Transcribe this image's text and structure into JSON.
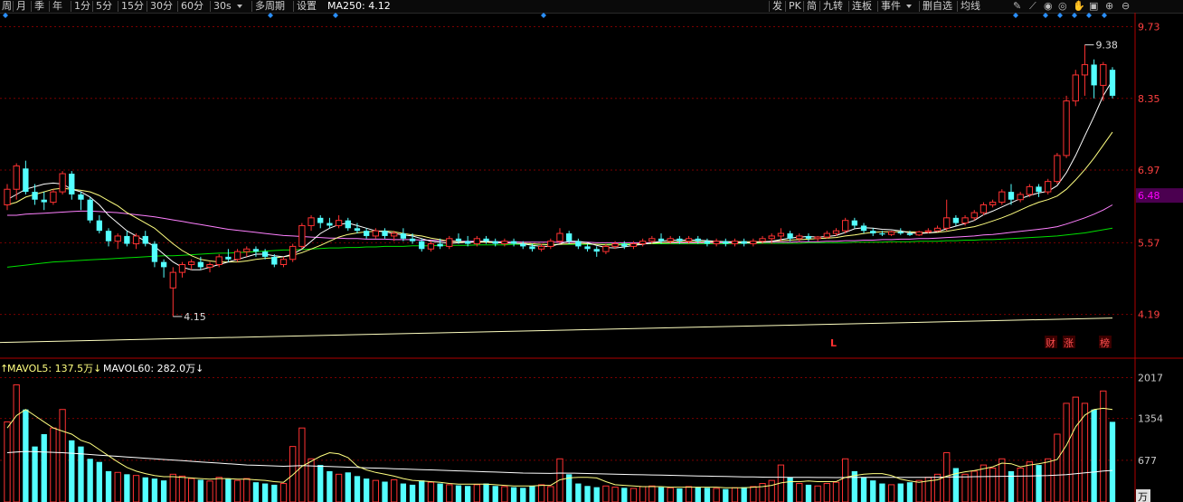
{
  "toolbar": {
    "left_items": [
      "周",
      "月",
      "季",
      "年",
      "1分",
      "5分",
      "15分",
      "30分",
      "60分",
      "30s",
      "多周期",
      "设置"
    ],
    "ma_label": "MA250: 4.12",
    "right_items": [
      "发",
      "PK",
      "简",
      "九转",
      "连板",
      "事件",
      "删自选",
      "均线"
    ]
  },
  "price_axis": {
    "ticks": [
      "9.73",
      "8.35",
      "6.97",
      "5.57",
      "4.19"
    ],
    "current_price": "6.48",
    "current_color": "#ff00ff"
  },
  "annotations": {
    "high_label": "9.38",
    "low_label": "4.15",
    "marker_l": "L",
    "markers_right": [
      "财",
      "涨",
      "榜"
    ]
  },
  "volume_panel": {
    "mavol5_label": "MAVOL5: 137.5万",
    "mavol60_label": "MAVOL60: 282.0万",
    "ticks": [
      "2017",
      "1354",
      "677"
    ],
    "unit": "万"
  },
  "colors": {
    "up": "#ff3232",
    "down": "#54ffff",
    "grid": "#7a0000",
    "ma5": "#ffffff",
    "ma10": "#ffff80",
    "ma30": "#ff80ff",
    "ma60": "#00e000",
    "ma250": "#ffffc0"
  },
  "chart_data": {
    "type": "candlestick",
    "y_range": [
      3.4,
      10.0
    ],
    "vol_range": [
      0,
      2200
    ],
    "high": 9.38,
    "low": 4.15,
    "ohlc": [
      [
        6.3,
        6.7,
        6.2,
        6.6
      ],
      [
        6.6,
        7.1,
        6.4,
        7.05
      ],
      [
        7.0,
        7.15,
        6.5,
        6.55
      ],
      [
        6.55,
        6.7,
        6.3,
        6.4
      ],
      [
        6.4,
        6.55,
        6.2,
        6.35
      ],
      [
        6.35,
        6.6,
        6.3,
        6.55
      ],
      [
        6.55,
        6.95,
        6.5,
        6.9
      ],
      [
        6.9,
        6.95,
        6.4,
        6.5
      ],
      [
        6.5,
        6.55,
        6.2,
        6.4
      ],
      [
        6.4,
        6.45,
        5.95,
        6.0
      ],
      [
        6.0,
        6.1,
        5.75,
        5.8
      ],
      [
        5.8,
        5.85,
        5.5,
        5.6
      ],
      [
        5.6,
        5.75,
        5.45,
        5.7
      ],
      [
        5.7,
        5.8,
        5.5,
        5.55
      ],
      [
        5.55,
        5.75,
        5.45,
        5.7
      ],
      [
        5.7,
        5.8,
        5.5,
        5.55
      ],
      [
        5.55,
        5.6,
        5.1,
        5.2
      ],
      [
        5.2,
        5.25,
        4.9,
        5.1
      ],
      [
        4.7,
        5.1,
        4.15,
        5.0
      ],
      [
        5.0,
        5.2,
        4.9,
        5.15
      ],
      [
        5.15,
        5.25,
        5.05,
        5.2
      ],
      [
        5.2,
        5.3,
        5.05,
        5.1
      ],
      [
        5.1,
        5.2,
        5.0,
        5.15
      ],
      [
        5.15,
        5.35,
        5.1,
        5.3
      ],
      [
        5.3,
        5.45,
        5.2,
        5.25
      ],
      [
        5.25,
        5.45,
        5.2,
        5.4
      ],
      [
        5.4,
        5.5,
        5.3,
        5.45
      ],
      [
        5.45,
        5.5,
        5.3,
        5.4
      ],
      [
        5.4,
        5.45,
        5.25,
        5.3
      ],
      [
        5.3,
        5.35,
        5.1,
        5.15
      ],
      [
        5.15,
        5.3,
        5.1,
        5.25
      ],
      [
        5.25,
        5.55,
        5.2,
        5.5
      ],
      [
        5.5,
        5.95,
        5.45,
        5.9
      ],
      [
        5.9,
        6.1,
        5.8,
        6.05
      ],
      [
        6.05,
        6.1,
        5.85,
        5.95
      ],
      [
        5.95,
        6.05,
        5.85,
        5.9
      ],
      [
        5.9,
        6.1,
        5.85,
        6.0
      ],
      [
        6.0,
        6.05,
        5.8,
        5.85
      ],
      [
        5.85,
        5.95,
        5.75,
        5.8
      ],
      [
        5.8,
        5.85,
        5.65,
        5.7
      ],
      [
        5.7,
        5.85,
        5.65,
        5.8
      ],
      [
        5.8,
        5.85,
        5.65,
        5.7
      ],
      [
        5.7,
        5.8,
        5.6,
        5.75
      ],
      [
        5.75,
        5.85,
        5.6,
        5.65
      ],
      [
        5.65,
        5.75,
        5.55,
        5.6
      ],
      [
        5.6,
        5.65,
        5.4,
        5.45
      ],
      [
        5.45,
        5.6,
        5.4,
        5.55
      ],
      [
        5.55,
        5.65,
        5.45,
        5.5
      ],
      [
        5.5,
        5.7,
        5.45,
        5.65
      ],
      [
        5.65,
        5.75,
        5.55,
        5.6
      ],
      [
        5.6,
        5.7,
        5.5,
        5.55
      ],
      [
        5.55,
        5.7,
        5.5,
        5.65
      ],
      [
        5.65,
        5.7,
        5.55,
        5.6
      ],
      [
        5.6,
        5.65,
        5.5,
        5.55
      ],
      [
        5.55,
        5.65,
        5.5,
        5.6
      ],
      [
        5.6,
        5.65,
        5.5,
        5.55
      ],
      [
        5.55,
        5.6,
        5.45,
        5.5
      ],
      [
        5.5,
        5.55,
        5.4,
        5.45
      ],
      [
        5.45,
        5.55,
        5.4,
        5.5
      ],
      [
        5.5,
        5.65,
        5.45,
        5.6
      ],
      [
        5.6,
        5.85,
        5.55,
        5.75
      ],
      [
        5.75,
        5.8,
        5.55,
        5.6
      ],
      [
        5.6,
        5.65,
        5.45,
        5.5
      ],
      [
        5.5,
        5.55,
        5.4,
        5.45
      ],
      [
        5.45,
        5.5,
        5.3,
        5.4
      ],
      [
        5.4,
        5.55,
        5.35,
        5.5
      ],
      [
        5.5,
        5.6,
        5.45,
        5.55
      ],
      [
        5.55,
        5.6,
        5.45,
        5.5
      ],
      [
        5.5,
        5.6,
        5.45,
        5.55
      ],
      [
        5.55,
        5.65,
        5.5,
        5.6
      ],
      [
        5.6,
        5.7,
        5.55,
        5.65
      ],
      [
        5.65,
        5.75,
        5.55,
        5.6
      ],
      [
        5.6,
        5.7,
        5.55,
        5.65
      ],
      [
        5.65,
        5.7,
        5.55,
        5.6
      ],
      [
        5.6,
        5.7,
        5.55,
        5.65
      ],
      [
        5.65,
        5.7,
        5.55,
        5.6
      ],
      [
        5.6,
        5.65,
        5.5,
        5.55
      ],
      [
        5.55,
        5.65,
        5.5,
        5.6
      ],
      [
        5.6,
        5.65,
        5.5,
        5.55
      ],
      [
        5.55,
        5.65,
        5.5,
        5.6
      ],
      [
        5.6,
        5.65,
        5.5,
        5.55
      ],
      [
        5.55,
        5.65,
        5.5,
        5.6
      ],
      [
        5.6,
        5.7,
        5.55,
        5.65
      ],
      [
        5.65,
        5.75,
        5.55,
        5.7
      ],
      [
        5.7,
        5.85,
        5.6,
        5.75
      ],
      [
        5.75,
        5.8,
        5.6,
        5.65
      ],
      [
        5.65,
        5.75,
        5.6,
        5.7
      ],
      [
        5.7,
        5.75,
        5.6,
        5.65
      ],
      [
        5.65,
        5.7,
        5.6,
        5.68
      ],
      [
        5.68,
        5.8,
        5.65,
        5.75
      ],
      [
        5.75,
        5.85,
        5.7,
        5.8
      ],
      [
        5.8,
        6.05,
        5.75,
        6.0
      ],
      [
        6.0,
        6.05,
        5.85,
        5.9
      ],
      [
        5.9,
        5.95,
        5.75,
        5.8
      ],
      [
        5.8,
        5.85,
        5.7,
        5.75
      ],
      [
        5.75,
        5.8,
        5.7,
        5.73
      ],
      [
        5.73,
        5.8,
        5.7,
        5.78
      ],
      [
        5.78,
        5.85,
        5.72,
        5.75
      ],
      [
        5.75,
        5.8,
        5.7,
        5.72
      ],
      [
        5.72,
        5.8,
        5.7,
        5.78
      ],
      [
        5.78,
        5.85,
        5.75,
        5.8
      ],
      [
        5.8,
        5.9,
        5.78,
        5.85
      ],
      [
        5.85,
        6.4,
        5.8,
        6.05
      ],
      [
        6.05,
        6.1,
        5.9,
        5.95
      ],
      [
        5.95,
        6.1,
        5.9,
        6.05
      ],
      [
        6.05,
        6.2,
        6.0,
        6.15
      ],
      [
        6.15,
        6.35,
        6.1,
        6.3
      ],
      [
        6.3,
        6.4,
        6.25,
        6.35
      ],
      [
        6.35,
        6.6,
        6.3,
        6.55
      ],
      [
        6.55,
        6.7,
        6.3,
        6.4
      ],
      [
        6.4,
        6.55,
        6.35,
        6.5
      ],
      [
        6.5,
        6.7,
        6.45,
        6.65
      ],
      [
        6.65,
        6.7,
        6.45,
        6.55
      ],
      [
        6.55,
        6.8,
        6.5,
        6.75
      ],
      [
        6.75,
        7.3,
        6.7,
        7.25
      ],
      [
        7.25,
        8.4,
        7.2,
        8.3
      ],
      [
        8.3,
        8.9,
        8.2,
        8.8
      ],
      [
        8.8,
        9.38,
        8.4,
        9.0
      ],
      [
        9.0,
        9.1,
        8.35,
        8.6
      ],
      [
        8.6,
        9.05,
        8.3,
        9.0
      ],
      [
        8.9,
        8.95,
        8.35,
        8.4
      ]
    ],
    "ma5": [
      6.4,
      6.5,
      6.6,
      6.65,
      6.7,
      6.72,
      6.7,
      6.6,
      6.55,
      6.45,
      6.3,
      6.1,
      5.95,
      5.8,
      5.7,
      5.6,
      5.5,
      5.35,
      5.2,
      5.1,
      5.05,
      5.05,
      5.1,
      5.15,
      5.2,
      5.25,
      5.3,
      5.35,
      5.35,
      5.32,
      5.3,
      5.35,
      5.45,
      5.6,
      5.75,
      5.85,
      5.92,
      5.95,
      5.9,
      5.85,
      5.8,
      5.78,
      5.75,
      5.72,
      5.7,
      5.65,
      5.6,
      5.58,
      5.56,
      5.57,
      5.58,
      5.59,
      5.6,
      5.58,
      5.57,
      5.56,
      5.55,
      5.52,
      5.5,
      5.5,
      5.55,
      5.6,
      5.6,
      5.57,
      5.52,
      5.48,
      5.47,
      5.49,
      5.52,
      5.54,
      5.57,
      5.6,
      5.62,
      5.62,
      5.62,
      5.62,
      5.61,
      5.6,
      5.59,
      5.58,
      5.57,
      5.57,
      5.58,
      5.6,
      5.63,
      5.66,
      5.68,
      5.69,
      5.68,
      5.69,
      5.71,
      5.77,
      5.84,
      5.86,
      5.85,
      5.83,
      5.82,
      5.8,
      5.76,
      5.75,
      5.76,
      5.78,
      5.84,
      5.89,
      5.94,
      6.0,
      6.11,
      6.18,
      6.26,
      6.34,
      6.42,
      6.48,
      6.53,
      6.56,
      6.67,
      6.92,
      7.25,
      7.63,
      8.0,
      8.4,
      8.7
    ],
    "ma10": [
      6.3,
      6.35,
      6.45,
      6.5,
      6.55,
      6.6,
      6.62,
      6.6,
      6.58,
      6.55,
      6.48,
      6.38,
      6.28,
      6.15,
      6.05,
      5.95,
      5.85,
      5.7,
      5.55,
      5.42,
      5.32,
      5.25,
      5.22,
      5.2,
      5.2,
      5.2,
      5.22,
      5.25,
      5.27,
      5.28,
      5.3,
      5.33,
      5.38,
      5.45,
      5.52,
      5.6,
      5.68,
      5.73,
      5.76,
      5.78,
      5.79,
      5.8,
      5.78,
      5.75,
      5.72,
      5.7,
      5.66,
      5.63,
      5.6,
      5.59,
      5.58,
      5.58,
      5.58,
      5.57,
      5.57,
      5.56,
      5.56,
      5.55,
      5.54,
      5.53,
      5.54,
      5.55,
      5.56,
      5.55,
      5.54,
      5.53,
      5.53,
      5.53,
      5.54,
      5.55,
      5.56,
      5.57,
      5.58,
      5.59,
      5.59,
      5.59,
      5.59,
      5.59,
      5.59,
      5.59,
      5.59,
      5.59,
      5.59,
      5.6,
      5.61,
      5.62,
      5.63,
      5.64,
      5.65,
      5.66,
      5.67,
      5.7,
      5.72,
      5.75,
      5.77,
      5.78,
      5.78,
      5.78,
      5.78,
      5.77,
      5.76,
      5.77,
      5.79,
      5.82,
      5.85,
      5.88,
      5.93,
      5.99,
      6.05,
      6.12,
      6.2,
      6.28,
      6.35,
      6.4,
      6.47,
      6.6,
      6.78,
      6.98,
      7.2,
      7.45,
      7.7
    ],
    "ma30": [
      6.1,
      6.1,
      6.12,
      6.13,
      6.14,
      6.15,
      6.16,
      6.17,
      6.18,
      6.18,
      6.17,
      6.16,
      6.15,
      6.13,
      6.11,
      6.09,
      6.07,
      6.04,
      6.01,
      5.98,
      5.95,
      5.92,
      5.89,
      5.86,
      5.83,
      5.81,
      5.79,
      5.77,
      5.75,
      5.73,
      5.71,
      5.7,
      5.69,
      5.68,
      5.67,
      5.66,
      5.66,
      5.65,
      5.65,
      5.64,
      5.64,
      5.64,
      5.63,
      5.63,
      5.63,
      5.62,
      5.62,
      5.61,
      5.61,
      5.6,
      5.6,
      5.6,
      5.6,
      5.59,
      5.59,
      5.59,
      5.58,
      5.58,
      5.58,
      5.58,
      5.58,
      5.58,
      5.58,
      5.58,
      5.57,
      5.57,
      5.57,
      5.57,
      5.57,
      5.57,
      5.57,
      5.57,
      5.57,
      5.57,
      5.57,
      5.57,
      5.57,
      5.57,
      5.57,
      5.57,
      5.57,
      5.57,
      5.58,
      5.58,
      5.58,
      5.58,
      5.59,
      5.59,
      5.59,
      5.6,
      5.6,
      5.61,
      5.61,
      5.62,
      5.62,
      5.63,
      5.63,
      5.64,
      5.64,
      5.65,
      5.65,
      5.66,
      5.67,
      5.68,
      5.69,
      5.7,
      5.72,
      5.73,
      5.75,
      5.77,
      5.79,
      5.81,
      5.83,
      5.85,
      5.88,
      5.93,
      5.99,
      6.05,
      6.12,
      6.2,
      6.3
    ],
    "ma60": [
      5.1,
      5.12,
      5.14,
      5.16,
      5.18,
      5.2,
      5.21,
      5.22,
      5.23,
      5.24,
      5.25,
      5.26,
      5.27,
      5.28,
      5.29,
      5.3,
      5.31,
      5.32,
      5.32,
      5.33,
      5.34,
      5.35,
      5.36,
      5.37,
      5.37,
      5.38,
      5.39,
      5.4,
      5.41,
      5.42,
      5.43,
      5.43,
      5.44,
      5.45,
      5.46,
      5.47,
      5.47,
      5.48,
      5.48,
      5.49,
      5.49,
      5.5,
      5.5,
      5.5,
      5.51,
      5.51,
      5.51,
      5.52,
      5.52,
      5.52,
      5.52,
      5.53,
      5.53,
      5.53,
      5.53,
      5.54,
      5.54,
      5.54,
      5.54,
      5.54,
      5.54,
      5.54,
      5.54,
      5.54,
      5.54,
      5.54,
      5.55,
      5.55,
      5.55,
      5.55,
      5.55,
      5.55,
      5.55,
      5.55,
      5.55,
      5.55,
      5.55,
      5.55,
      5.55,
      5.55,
      5.56,
      5.56,
      5.56,
      5.56,
      5.56,
      5.56,
      5.56,
      5.57,
      5.57,
      5.57,
      5.57,
      5.57,
      5.58,
      5.58,
      5.58,
      5.58,
      5.59,
      5.59,
      5.59,
      5.6,
      5.6,
      5.6,
      5.61,
      5.61,
      5.62,
      5.62,
      5.63,
      5.63,
      5.64,
      5.65,
      5.66,
      5.67,
      5.68,
      5.69,
      5.7,
      5.72,
      5.74,
      5.76,
      5.79,
      5.82,
      5.85
    ],
    "ma250": [
      3.65,
      4.12
    ],
    "volume": [
      1300,
      1900,
      1500,
      900,
      1100,
      1200,
      1500,
      1000,
      900,
      700,
      650,
      500,
      480,
      450,
      430,
      400,
      380,
      350,
      450,
      420,
      380,
      360,
      340,
      400,
      380,
      350,
      380,
      320,
      300,
      280,
      300,
      900,
      1200,
      700,
      600,
      500,
      450,
      480,
      420,
      380,
      350,
      330,
      360,
      300,
      280,
      350,
      320,
      300,
      280,
      270,
      260,
      280,
      300,
      260,
      250,
      240,
      230,
      260,
      280,
      250,
      700,
      450,
      300,
      260,
      240,
      260,
      240,
      230,
      220,
      250,
      260,
      240,
      230,
      220,
      250,
      240,
      230,
      220,
      210,
      230,
      240,
      250,
      300,
      350,
      600,
      400,
      300,
      280,
      260,
      300,
      320,
      700,
      500,
      400,
      350,
      300,
      280,
      300,
      320,
      350,
      400,
      450,
      800,
      550,
      450,
      500,
      600,
      550,
      700,
      500,
      550,
      650,
      600,
      700,
      1100,
      1600,
      1700,
      1600,
      1500,
      1800,
      1300
    ],
    "mavol5": [
      1200,
      1400,
      1500,
      1400,
      1300,
      1200,
      1150,
      1100,
      1000,
      950,
      850,
      750,
      650,
      560,
      500,
      460,
      430,
      410,
      410,
      400,
      390,
      380,
      370,
      380,
      380,
      370,
      370,
      360,
      350,
      330,
      320,
      440,
      580,
      660,
      740,
      800,
      780,
      720,
      580,
      520,
      480,
      450,
      420,
      380,
      350,
      340,
      330,
      320,
      300,
      290,
      290,
      290,
      290,
      280,
      270,
      260,
      260,
      260,
      270,
      270,
      360,
      390,
      400,
      400,
      390,
      330,
      280,
      270,
      260,
      250,
      250,
      250,
      240,
      240,
      240,
      240,
      240,
      240,
      230,
      230,
      230,
      240,
      250,
      270,
      310,
      330,
      330,
      340,
      330,
      330,
      330,
      400,
      430,
      450,
      460,
      460,
      430,
      370,
      340,
      320,
      340,
      360,
      420,
      460,
      490,
      510,
      540,
      570,
      630,
      620,
      570,
      600,
      620,
      650,
      690,
      920,
      1220,
      1410,
      1500,
      1520,
      1500
    ],
    "mavol60": [
      800,
      810,
      820,
      815,
      810,
      805,
      800,
      790,
      780,
      770,
      760,
      750,
      740,
      730,
      720,
      710,
      700,
      690,
      680,
      670,
      660,
      650,
      640,
      630,
      620,
      610,
      600,
      595,
      590,
      585,
      580,
      585,
      590,
      585,
      580,
      575,
      570,
      565,
      560,
      555,
      550,
      545,
      540,
      535,
      530,
      525,
      520,
      515,
      510,
      505,
      500,
      495,
      490,
      485,
      480,
      475,
      470,
      468,
      466,
      464,
      470,
      468,
      466,
      462,
      458,
      454,
      450,
      447,
      444,
      441,
      438,
      435,
      432,
      429,
      426,
      423,
      420,
      417,
      414,
      411,
      408,
      406,
      404,
      402,
      402,
      401,
      400,
      399,
      398,
      397,
      396,
      398,
      399,
      400,
      400,
      400,
      400,
      400,
      400,
      400,
      401,
      402,
      405,
      407,
      408,
      410,
      412,
      414,
      417,
      418,
      420,
      423,
      426,
      429,
      435,
      445,
      458,
      472,
      486,
      502,
      512
    ]
  }
}
